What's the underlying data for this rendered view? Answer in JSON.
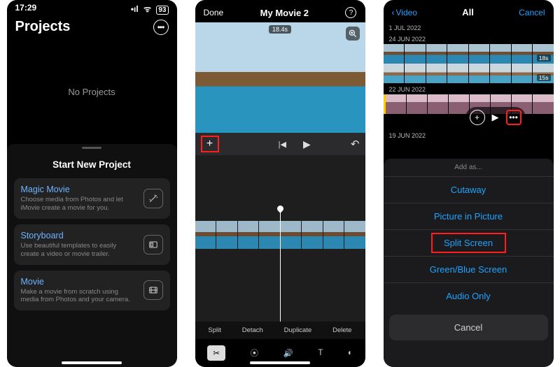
{
  "phone1": {
    "status": {
      "time": "17:29",
      "signal": "•ıl",
      "wifi": "ᯤ",
      "battery": "93"
    },
    "header": {
      "title": "Projects",
      "more_icon": "•••"
    },
    "empty": "No Projects",
    "sheet": {
      "title": "Start New Project",
      "cards": [
        {
          "title": "Magic Movie",
          "sub": "Choose media from Photos and let iMovie create a movie for you.",
          "icon": "wand-icon"
        },
        {
          "title": "Storyboard",
          "sub": "Use beautiful templates to easily create a video or movie trailer.",
          "icon": "storyboard-icon"
        },
        {
          "title": "Movie",
          "sub": "Make a movie from scratch using media from Photos and your camera.",
          "icon": "film-icon"
        }
      ]
    }
  },
  "phone2": {
    "nav": {
      "done": "Done",
      "title": "My Movie 2",
      "help": "?"
    },
    "preview": {
      "time_tag": "18.4s"
    },
    "controls": {
      "add": "+",
      "prev": "|◀",
      "play": "▶",
      "undo": "↶"
    },
    "actions": [
      "Split",
      "Detach",
      "Duplicate",
      "Delete"
    ],
    "toolbar": {
      "cut": "✂",
      "speed": "⦿",
      "volume": "🔊",
      "text": "T",
      "filter": "◐"
    }
  },
  "phone3": {
    "nav": {
      "back": "Video",
      "title": "All",
      "cancel": "Cancel"
    },
    "groups": [
      {
        "date": "1 JUL 2022",
        "strips": []
      },
      {
        "date": "24 JUN 2022",
        "strips": [
          {
            "len": "18s"
          },
          {
            "len": "15s"
          }
        ]
      },
      {
        "date": "22 JUN 2022",
        "strips": [
          {
            "selected": true
          }
        ]
      },
      {
        "date": "19 JUN 2022",
        "strips": []
      }
    ],
    "overlay": {
      "add": "+",
      "play": "▶",
      "more": "•••"
    },
    "sheet": {
      "header": "Add as...",
      "options": [
        "Cutaway",
        "Picture in Picture",
        "Split Screen",
        "Green/Blue Screen",
        "Audio Only"
      ],
      "selected_index": 2,
      "cancel": "Cancel"
    }
  }
}
